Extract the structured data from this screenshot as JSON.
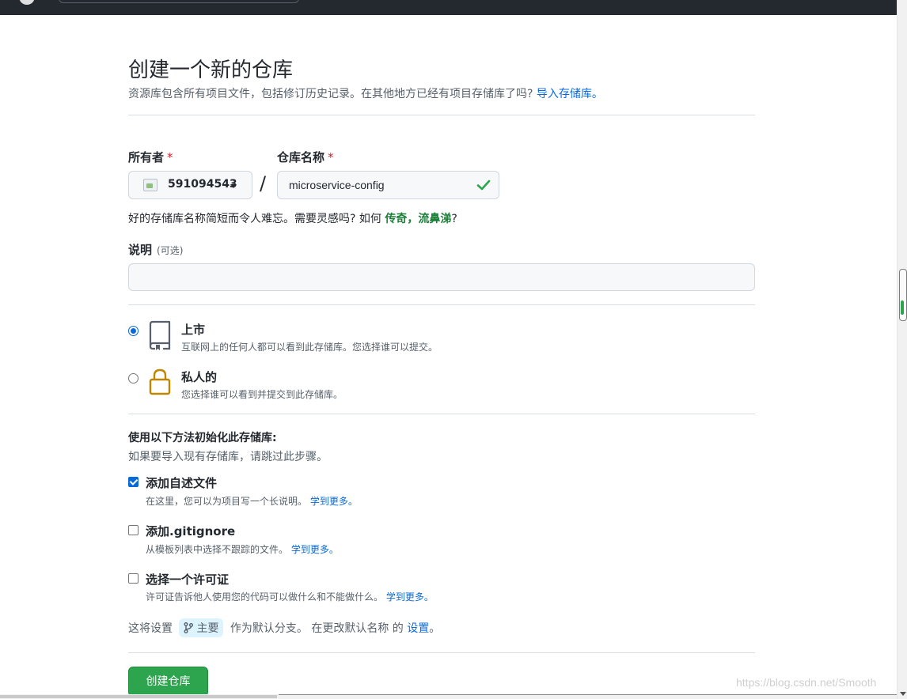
{
  "header": {
    "logo": "github-logo",
    "search_placeholder": ""
  },
  "page": {
    "title": "创建一个新的仓库",
    "subtitle": "资源库包含所有项目文件，包括修订历史记录。在其他地方已经有项目存储库了吗?",
    "import_link": "导入存储库。"
  },
  "owner": {
    "label": "所有者",
    "required_mark": "*",
    "value": "591094543",
    "avatar_icon": "broken-image-icon"
  },
  "separator": "/",
  "repo_name": {
    "label": "仓库名称",
    "required_mark": "*",
    "value": "microservice-config",
    "valid_icon": "check-icon"
  },
  "name_hint": {
    "prefix": "好的存储库名称简短而令人难忘。需要灵感吗? 如何",
    "suggestion": "传奇，流鼻涕",
    "suffix": "?"
  },
  "description": {
    "label": "说明",
    "optional": "(可选)",
    "value": ""
  },
  "visibility": {
    "public": {
      "title": "上市",
      "desc": "互联网上的任何人都可以看到此存储库。您选择谁可以提交。",
      "selected": true,
      "icon": "repo-icon"
    },
    "private": {
      "title": "私人的",
      "desc": "您选择谁可以看到并提交到此存储库。",
      "selected": false,
      "icon": "lock-icon"
    }
  },
  "init": {
    "title": "使用以下方法初始化此存储库:",
    "subtitle": "如果要导入现有存储库，请跳过此步骤。",
    "options": [
      {
        "title": "添加自述文件",
        "desc": "在这里，您可以为项目写一个长说明。",
        "link": "学到更多。",
        "checked": true
      },
      {
        "title": "添加.gitignore",
        "desc": "从模板列表中选择不跟踪的文件。",
        "link": "学到更多。",
        "checked": false
      },
      {
        "title": "选择一个许可证",
        "desc": "许可证告诉他人使用您的代码可以做什么和不能做什么。",
        "link": "学到更多。",
        "checked": false
      }
    ]
  },
  "branch": {
    "prefix": "这将设置",
    "name": "主要",
    "middle": "作为默认分支。 在更改默认名称 的",
    "link": "设置",
    "suffix": "。"
  },
  "create_button": "创建仓库",
  "watermark": "https://blog.csdn.net/Smooth",
  "colors": {
    "accent": "#0969da",
    "success": "#2da44e",
    "danger": "#cf222e",
    "topbar": "#24292f"
  }
}
